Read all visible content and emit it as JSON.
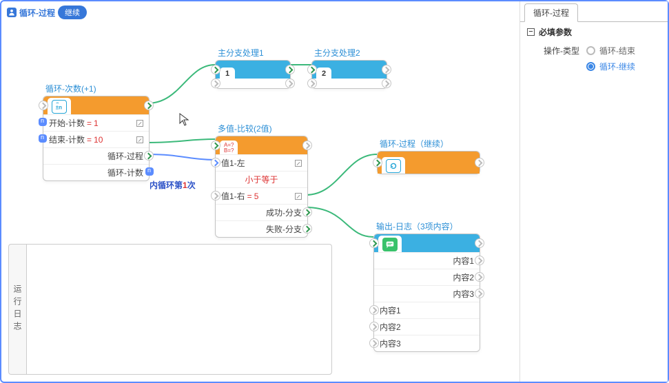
{
  "titlebar": {
    "title": "循环-过程",
    "pill": "继续"
  },
  "nodes": {
    "loop": {
      "label": "循环-次数(+1)",
      "p1_label": "开始-计数",
      "p1_val": "1",
      "p2_label": "结束-计数",
      "p2_val": "10",
      "p3_label": "循环-过程",
      "p4_label": "循环-计数"
    },
    "branch1": {
      "label": "主分支处理1",
      "tab": "1"
    },
    "branch2": {
      "label": "主分支处理2",
      "tab": "2"
    },
    "compare": {
      "label": "多值-比较(2值)",
      "r1": "值1-左",
      "r2": "小于等于",
      "r3_label": "值1-右",
      "r3_val": "5",
      "r4": "成功-分支",
      "r5": "失败-分支"
    },
    "loopproc": {
      "label": "循环-过程（继续）"
    },
    "output": {
      "label": "输出-日志（3项内容）",
      "right_items": [
        "内容1",
        "内容2",
        "内容3"
      ],
      "left_items": [
        "内容1",
        "内容2",
        "内容3"
      ]
    }
  },
  "anno": {
    "inner": "内循环第1次",
    "_inner_parts": [
      "内循环第",
      "1",
      "次"
    ]
  },
  "log": {
    "tab": "运行日志"
  },
  "sidebar": {
    "tab": "循环-过程",
    "section": "必填参数",
    "field": "操作-类型",
    "radios": [
      "循环-结束",
      "循环-继续"
    ],
    "selected": 1
  }
}
